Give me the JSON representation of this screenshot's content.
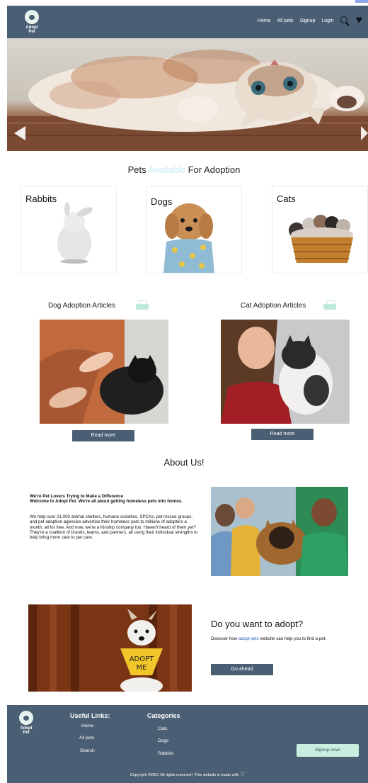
{
  "header": {
    "logo_text": "Adopt\nPet",
    "nav": [
      "Home",
      "All pets",
      "Signup",
      "Login"
    ]
  },
  "available": {
    "title_prefix": "Pets",
    "title_accent": "Available",
    "title_suffix": "For Adoption",
    "cards": [
      {
        "name": "Rabbits"
      },
      {
        "name": "Dogs"
      },
      {
        "name": "Cats"
      }
    ]
  },
  "articles": {
    "dog_title": "Dog Adoption Articles",
    "cat_title": "Cat Adoption Articles",
    "read_more": "Read more"
  },
  "about": {
    "title": "About Us!",
    "lead_line1": "We're Pet Lovers Trying to Make a Difference",
    "lead_line2": "Welcome to Adopt Pet. We're all about getting homeless pets into homes.",
    "body": "We help over 21,000 animal shelters, humane societies, SPCAs, pet rescue groups, and pet adoption agencies advertise their homeless pets to millions of adopters a month, all for free. And now, we're a Kinship company too. Haven't heard of them yet? They're a coalition of brands, teams, and partners, all using their individual strengths to help bring more care to pet care."
  },
  "adopt": {
    "title": "Do you want to adopt?",
    "desc_prefix": "Discover how",
    "desc_link": "adopt pets",
    "desc_suffix": "website can help you to find a pet.",
    "button": "Go ahead"
  },
  "footer": {
    "logo_text": "Adopt\nPet",
    "useful_links_title": "Useful Links:",
    "useful_links": [
      "Home",
      "All pets",
      "Search"
    ],
    "categories_title": "Categories",
    "categories": [
      "Cats",
      "Dogs",
      "Rabbits"
    ],
    "signup_button": "Signup now!",
    "copyright": "Copyright ©2021 All rights reserved | This website is made with"
  },
  "colors": {
    "primary": "#4a5f74",
    "accent": "#c4ecf0",
    "signup": "#c9eee0"
  }
}
